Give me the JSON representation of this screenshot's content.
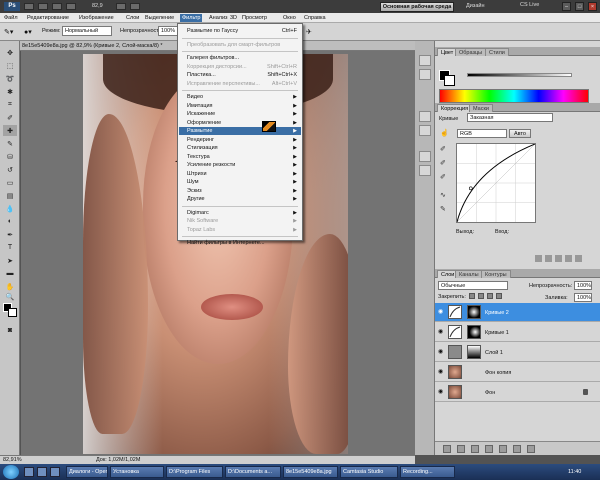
{
  "app": {
    "logo": "Ps",
    "zoom": "82,9",
    "workspace_button": "Основная рабочая среда",
    "design_label": "Дизайн",
    "cslive_label": "CS Live"
  },
  "menubar": [
    "Файл",
    "Редактирование",
    "Изображение",
    "Слои",
    "Выделение",
    "Фильтр",
    "Анализ",
    "3D",
    "Просмотр",
    "Окно",
    "Справка"
  ],
  "menubar_active": "Фильтр",
  "options": {
    "mode_label": "Режим:",
    "mode_value": "Нормальный",
    "opacity_label": "Непрозрачность:",
    "opacity_value": "100%"
  },
  "document": {
    "tab_title": "8e15e5409e8a.jpg @ 82,9% (Кривые 2, Слой-маска/8) *"
  },
  "status": {
    "zoom": "82,91%",
    "doc": "Док: 1,02M/1,02M"
  },
  "filter_menu": {
    "items": [
      {
        "label": "Размытие по Гауссу",
        "shortcut": "Ctrl+F",
        "state": "normal"
      },
      {
        "sep": true
      },
      {
        "label": "Преобразовать для смарт-фильтров",
        "state": "disabled"
      },
      {
        "sep": true
      },
      {
        "label": "Галерея фильтров...",
        "state": "normal"
      },
      {
        "label": "Коррекция дисторсии...",
        "shortcut": "Shift+Ctrl+R",
        "state": "disabled"
      },
      {
        "label": "Пластика...",
        "shortcut": "Shift+Ctrl+X",
        "state": "normal"
      },
      {
        "label": "Исправление перспективы...",
        "shortcut": "Alt+Ctrl+V",
        "state": "disabled"
      },
      {
        "sep": true
      },
      {
        "label": "Видео",
        "submenu": true,
        "state": "normal"
      },
      {
        "label": "Имитация",
        "submenu": true,
        "state": "normal"
      },
      {
        "label": "Искажение",
        "submenu": true,
        "state": "normal"
      },
      {
        "label": "Оформление",
        "submenu": true,
        "state": "normal"
      },
      {
        "label": "Размытие",
        "submenu": true,
        "state": "highlight"
      },
      {
        "label": "Рендеринг",
        "submenu": true,
        "state": "normal"
      },
      {
        "label": "Стилизация",
        "submenu": true,
        "state": "normal"
      },
      {
        "label": "Текстура",
        "submenu": true,
        "state": "normal"
      },
      {
        "label": "Усиление резкости",
        "submenu": true,
        "state": "normal"
      },
      {
        "label": "Штрихи",
        "submenu": true,
        "state": "normal"
      },
      {
        "label": "Шум",
        "submenu": true,
        "state": "normal"
      },
      {
        "label": "Эскиз",
        "submenu": true,
        "state": "normal"
      },
      {
        "label": "Другие",
        "submenu": true,
        "state": "normal"
      },
      {
        "sep": true
      },
      {
        "label": "Digimarc",
        "submenu": true,
        "state": "normal"
      },
      {
        "label": "Nik Software",
        "submenu": true,
        "state": "disabled"
      },
      {
        "label": "Topaz Labs",
        "submenu": true,
        "state": "disabled"
      },
      {
        "sep": true
      },
      {
        "label": "Найти фильтры в Интернете...",
        "state": "normal"
      }
    ]
  },
  "panels": {
    "color_tabs": [
      "Цвет",
      "Образцы",
      "Стили"
    ],
    "adjust_tabs": [
      "Коррекция",
      "Маски"
    ],
    "adjust_title": "Кривые",
    "preset": "Заказная",
    "channel": "RGB",
    "auto_button": "Авто",
    "output_label": "Выход:",
    "input_label": "Вход:",
    "layers_tabs": [
      "Слои",
      "Каналы",
      "Контуры"
    ],
    "blend_mode": "Обычные",
    "opacity_label": "Непрозрачность:",
    "opacity_value": "100%",
    "lock_label": "Закрепить:",
    "fill_label": "Заливка:",
    "fill_value": "100%",
    "layers": [
      {
        "name": "Кривые 2",
        "selected": true,
        "type": "adjust"
      },
      {
        "name": "Кривые 1",
        "selected": false,
        "type": "adjust"
      },
      {
        "name": "Слой 1",
        "selected": false,
        "type": "gray"
      },
      {
        "name": "Фон копия",
        "selected": false,
        "type": "photo"
      },
      {
        "name": "Фон",
        "selected": false,
        "type": "photo",
        "locked": true
      }
    ]
  },
  "taskbar": {
    "tasks": [
      "Диалоги - Opera",
      "Установка",
      "D:\\Program Files",
      "D:\\Documents a...",
      "8e15e5409e8a.jpg",
      "Camtasia Studio",
      "Recording..."
    ],
    "clock": "11:40"
  },
  "colors": {
    "menu_highlight": "#3a6ea5",
    "layer_selected": "#3d8ee0"
  },
  "curve": {
    "points": [
      [
        0,
        0
      ],
      [
        45,
        110
      ],
      [
        255,
        255
      ]
    ]
  }
}
